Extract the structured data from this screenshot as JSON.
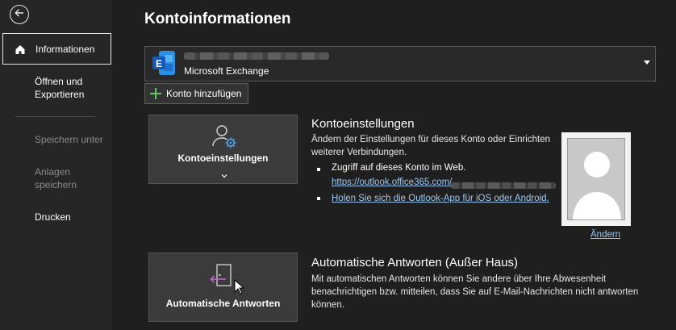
{
  "sidebar": {
    "back_icon": "arrow-left-icon",
    "items": [
      {
        "label": "Informationen",
        "icon": "home-icon",
        "active": true
      },
      {
        "label": "Öffnen und Exportieren"
      },
      {
        "label": "Speichern unter",
        "disabled": true
      },
      {
        "label": "Anlagen speichern",
        "disabled": true
      },
      {
        "label": "Drucken"
      }
    ]
  },
  "main": {
    "title": "Kontoinformationen",
    "account": {
      "type": "Microsoft Exchange",
      "icon": "exchange-icon"
    },
    "add_account_label": "Konto hinzufügen",
    "account_settings": {
      "button_label": "Kontoeinstellungen",
      "button_icon": "user-settings-icon",
      "title": "Kontoeinstellungen",
      "description": "Ändern der Einstellungen für dieses Konto oder Einrichten weiterer Verbindungen.",
      "bullet1_text": "Zugriff auf dieses Konto im Web.",
      "bullet1_link": "https://outlook.office365.com/",
      "bullet2_link": "Holen Sie sich die Outlook-App für iOS oder Android."
    },
    "profile": {
      "change_label": "Ändern"
    },
    "auto_reply": {
      "button_label": "Automatische Antworten",
      "button_icon": "door-arrow-icon",
      "title": "Automatische Antworten (Außer Haus)",
      "description": "Mit automatischen Antworten können Sie andere über Ihre Abwesenheit benachrichtigen bzw. mitteilen, dass Sie auf E-Mail-Nachrichten nicht antworten können."
    }
  },
  "colors": {
    "background": "#1f1f1f",
    "sidebar": "#262626",
    "link": "#9ec8f2",
    "accent_green": "#6cc26c",
    "exchange_blue": "#1f6fd0"
  }
}
